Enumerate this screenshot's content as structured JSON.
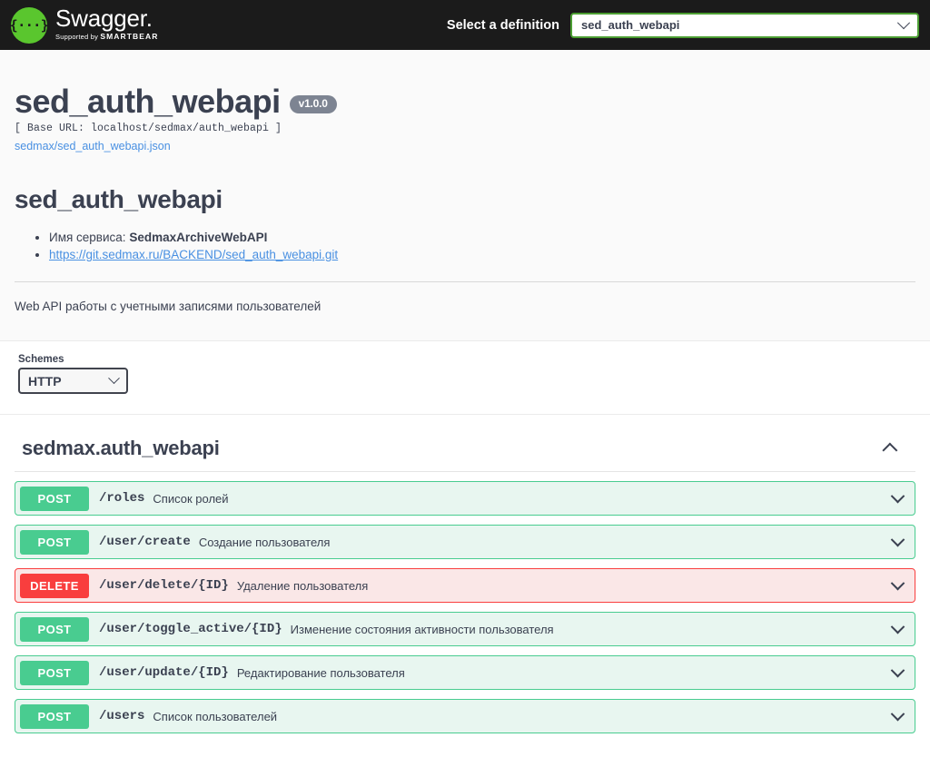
{
  "topbar": {
    "logo_title": "Swagger",
    "logo_supported_prefix": "Supported by ",
    "logo_supported_brand": "SMARTBEAR",
    "definition_label": "Select a definition",
    "definition_value": "sed_auth_webapi",
    "accent_green": "#5ac62e",
    "select_border": "#4c9e33",
    "background": "#1b1b1b"
  },
  "info": {
    "title": "sed_auth_webapi",
    "version": "v1.0.0",
    "base_url": "[ Base URL: localhost/sedmax/auth_webapi ]",
    "json_link": "sedmax/sed_auth_webapi.json",
    "description_title": "sed_auth_webapi",
    "bullets": [
      {
        "label": "Имя сервиса:",
        "value": "SedmaxArchiveWebAPI",
        "is_link": false
      },
      {
        "label": "",
        "value": "https://git.sedmax.ru/BACKEND/sed_auth_webapi.git",
        "is_link": true
      }
    ],
    "description_text": "Web API работы с учетными записями пользователей"
  },
  "schemes": {
    "label": "Schemes",
    "selected": "HTTP",
    "options": [
      "HTTP"
    ]
  },
  "tag": {
    "name": "sedmax.auth_webapi",
    "expanded": true
  },
  "operations": [
    {
      "method": "POST",
      "path": "/roles",
      "summary": "Список ролей",
      "color": "#49cc90",
      "bg": "#e8f6f0"
    },
    {
      "method": "POST",
      "path": "/user/create",
      "summary": "Создание пользователя",
      "color": "#49cc90",
      "bg": "#e8f6f0"
    },
    {
      "method": "DELETE",
      "path": "/user/delete/{ID}",
      "summary": "Удаление пользователя",
      "color": "#f93e3e",
      "bg": "#fae7e7"
    },
    {
      "method": "POST",
      "path": "/user/toggle_active/{ID}",
      "summary": "Изменение состояния активности пользователя",
      "color": "#49cc90",
      "bg": "#e8f6f0"
    },
    {
      "method": "POST",
      "path": "/user/update/{ID}",
      "summary": "Редактирование пользователя",
      "color": "#49cc90",
      "bg": "#e8f6f0"
    },
    {
      "method": "POST",
      "path": "/users",
      "summary": "Список пользователей",
      "color": "#49cc90",
      "bg": "#e8f6f0"
    }
  ]
}
